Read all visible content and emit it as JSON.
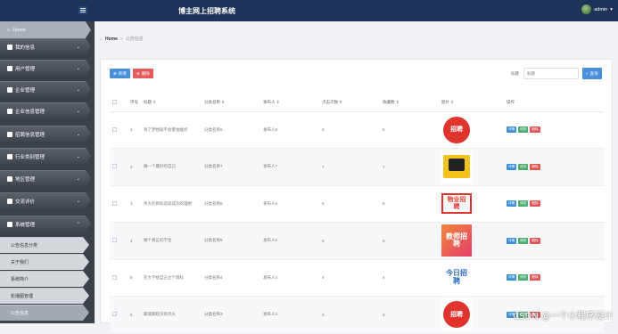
{
  "app": {
    "title": "博主网上招聘系统",
    "user": "admin"
  },
  "sidebar": {
    "home": "Home",
    "items": [
      {
        "label": "我的信息"
      },
      {
        "label": "用户管理"
      },
      {
        "label": "企业管理"
      },
      {
        "label": "企业信息管理"
      },
      {
        "label": "招聘信息管理"
      },
      {
        "label": "行业类别管理"
      },
      {
        "label": "地区管理"
      },
      {
        "label": "交流评价"
      },
      {
        "label": "系统管理"
      }
    ],
    "subitems": [
      {
        "label": "公告信息分类"
      },
      {
        "label": "关于我们"
      },
      {
        "label": "系统简介"
      },
      {
        "label": "轮播图管理"
      },
      {
        "label": "公告信息"
      }
    ]
  },
  "breadcrumb": {
    "home": "Home",
    "sep": "»",
    "current": "公告信息"
  },
  "toolbar": {
    "add_label": "新增",
    "delete_label": "删除",
    "search_label": "标题",
    "search_placeholder": "标题",
    "search_button": "查询"
  },
  "table": {
    "headers": [
      "序号",
      "标题 ⇕",
      "分类名称 ⇕",
      "发布人 ⇕",
      "点击次数 ⇕",
      "收藏数 ⇕",
      "图片 ⇕",
      "操作"
    ],
    "rows": [
      {
        "no": "1",
        "title": "有了梦想就不会害怕挫折",
        "category": "分类名称6",
        "publisher": "发布人8",
        "clicks": "8",
        "favorites": "8",
        "image_text": "招聘"
      },
      {
        "no": "2",
        "title": "做一个最好的自己",
        "category": "分类名称7",
        "publisher": "发布人7",
        "clicks": "7",
        "favorites": "7",
        "image_text": ""
      },
      {
        "no": "3",
        "title": "伟大的目标造就成功的理想",
        "category": "分类名称8",
        "publisher": "发布人6",
        "clicks": "6",
        "favorites": "6",
        "image_text": "物业招聘"
      },
      {
        "no": "4",
        "title": "做个真正的学生",
        "category": "分类名称5",
        "publisher": "发布人5",
        "clicks": "5",
        "favorites": "5",
        "image_text": "教师招聘"
      },
      {
        "no": "5",
        "title": "在大学给自己立个目标",
        "category": "分类名称4",
        "publisher": "发布人4",
        "clicks": "4",
        "favorites": "4",
        "image_text": "今日招聘"
      },
      {
        "no": "6",
        "title": "最遥路程没有尽头",
        "category": "分类名称3",
        "publisher": "发布人3",
        "clicks": "3",
        "favorites": "3",
        "image_text": "招聘"
      }
    ],
    "actions": {
      "detail": "详情",
      "edit": "修改",
      "delete": "删除"
    }
  },
  "watermark": "CSDN @一个小程序设计",
  "colors": {
    "topbar": "#1f3358",
    "sidebar": "#3b4148",
    "primary": "#4a8fdc",
    "danger": "#e25c5c",
    "success": "#4aac6e"
  }
}
